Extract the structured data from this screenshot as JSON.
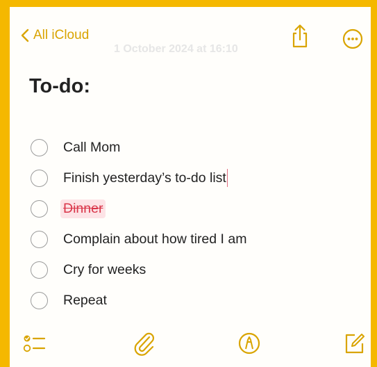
{
  "nav": {
    "back_label": "All iCloud",
    "timestamp": "1 October 2024 at 16:10",
    "back_icon": "chevron-left-icon",
    "share_icon": "share-icon",
    "more_icon": "ellipsis-circle-icon"
  },
  "note": {
    "title": "To-do:",
    "items": [
      {
        "text": "Call Mom",
        "struck": false
      },
      {
        "text": "Finish yesterday’s to-do list",
        "struck": false
      },
      {
        "text": "Dinner",
        "struck": true
      },
      {
        "text": "Complain about how tired I am",
        "struck": false
      },
      {
        "text": "Cry for weeks",
        "struck": false
      },
      {
        "text": "Repeat",
        "struck": false
      }
    ]
  },
  "toolbar": {
    "icons": [
      "checklist-icon",
      "paperclip-icon",
      "markup-pen-icon",
      "compose-icon"
    ]
  },
  "colors": {
    "accent": "#d9a400",
    "frame": "#f5b800",
    "strike": "#d9364a"
  }
}
